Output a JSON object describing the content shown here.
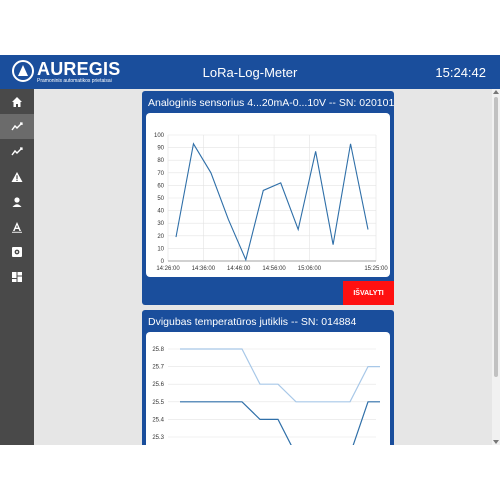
{
  "header": {
    "brand": "AUREGIS",
    "brand_sub": "Pramoninis automatikos prietaisai",
    "title": "LoRa-Log-Meter",
    "clock": "15:24:42"
  },
  "sidebar": {
    "items": [
      {
        "icon": "home-icon"
      },
      {
        "icon": "chart-line-icon",
        "active": true
      },
      {
        "icon": "chart-line-icon"
      },
      {
        "icon": "warning-icon"
      },
      {
        "icon": "user-icon"
      },
      {
        "icon": "logo-a-icon"
      },
      {
        "icon": "settings-icon"
      },
      {
        "icon": "dashboard-icon"
      }
    ]
  },
  "sensors": [
    {
      "title": "Analoginis sensorius 4...20mA-0...10V -- SN: 020101",
      "button": "IŠVALYTI",
      "chart_data": {
        "type": "line",
        "x": [
          "14:27",
          "14:31",
          "14:35",
          "14:40",
          "14:46",
          "14:50",
          "14:54",
          "14:59",
          "15:02",
          "15:06",
          "15:09",
          "15:13"
        ],
        "xticks": [
          "14:26:00",
          "14:36:00",
          "14:46:00",
          "14:56:00",
          "15:06:00",
          "15:25:00"
        ],
        "values": [
          19,
          93,
          70,
          33,
          1,
          56,
          62,
          25,
          87,
          13,
          93,
          25
        ],
        "ylim": [
          0,
          100
        ],
        "yticks": [
          "100",
          "90",
          "80",
          "70",
          "60",
          "50",
          "40",
          "30",
          "20",
          "10",
          "0"
        ],
        "line_color": "#2f6fa8"
      }
    },
    {
      "title": "Dvigubas temperatūros jutiklis -- SN: 014884",
      "chart_data": {
        "type": "line",
        "yticks": [
          "25.8",
          "25.7",
          "25.6",
          "25.5",
          "25.4",
          "25.3"
        ],
        "ylim": [
          25.28,
          25.82
        ],
        "series": [
          {
            "values": [
              25.8,
              25.8,
              25.8,
              25.8,
              25.6,
              25.6,
              25.5,
              25.5,
              25.5,
              25.5,
              25.7,
              25.7
            ],
            "color": "#a8c8e8"
          },
          {
            "values": [
              25.5,
              25.5,
              25.5,
              25.5,
              25.4,
              25.4,
              25.2,
              25.2,
              25.2,
              25.2,
              25.5,
              25.5
            ],
            "color": "#2f6fa8"
          }
        ]
      }
    }
  ]
}
